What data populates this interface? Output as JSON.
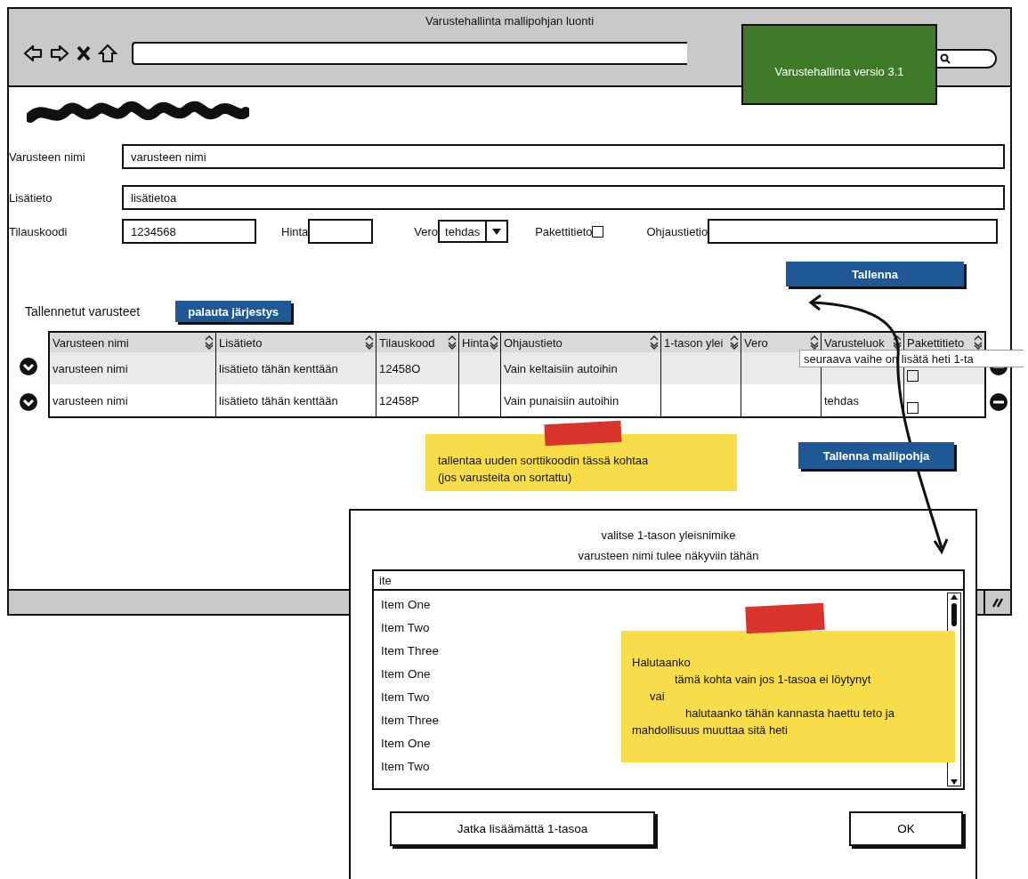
{
  "window": {
    "title": "Varustehallinta mallipohjan luonti"
  },
  "version_badge": "Varustehallinta versio 3.1",
  "form": {
    "rows": [
      {
        "kind": "wide",
        "label": "Varusteen nimi",
        "value": "varusteen nimi"
      },
      {
        "kind": "wide",
        "label": "Lisätieto",
        "value": "lisätietoa"
      }
    ],
    "inline": [
      {
        "kind": "text",
        "label": "Tilauskoodi",
        "value": "1234568"
      },
      {
        "kind": "text",
        "label": "Hinta"
      },
      {
        "kind": "select",
        "label": "Vero",
        "value": "tehdas"
      },
      {
        "kind": "checkbox",
        "label": "Pakettitieto",
        "checked": false
      },
      {
        "kind": "text",
        "label": "Ohjaustietio"
      }
    ]
  },
  "save_button": "Tallenna",
  "saved_label": "Tallennetut varusteet",
  "reset_order_button": "palauta järjestys",
  "table": {
    "columns": [
      "Varusteen nimi",
      "Lisätieto",
      "Tilauskood",
      "Hinta",
      "Ohjaustieto",
      "1-tason ylei",
      "Vero",
      "Varusteluok",
      "Pakettitieto"
    ],
    "rows": [
      {
        "selected": true,
        "cells": [
          {
            "kind": "text",
            "text": "varusteen nimi"
          },
          {
            "kind": "text",
            "text": "lisätieto tähän kenttään"
          },
          {
            "kind": "text",
            "text": "12458O"
          },
          {
            "kind": "empty"
          },
          {
            "kind": "text",
            "text": "Vain keltaisiin autoihin"
          },
          {
            "kind": "empty"
          },
          {
            "kind": "empty"
          },
          {
            "kind": "empty"
          },
          {
            "kind": "checkbox",
            "checked": false
          }
        ]
      },
      {
        "selected": false,
        "cells": [
          {
            "kind": "text",
            "text": "varusteen nimi"
          },
          {
            "kind": "text",
            "text": "lisätieto tähän kenttään"
          },
          {
            "kind": "text",
            "text": "12458P"
          },
          {
            "kind": "empty"
          },
          {
            "kind": "text",
            "text": "Vain punaisiin autoihin"
          },
          {
            "kind": "empty"
          },
          {
            "kind": "empty"
          },
          {
            "kind": "text",
            "text": "tehdas"
          },
          {
            "kind": "checkbox",
            "checked": false
          }
        ]
      }
    ]
  },
  "tooltip": "seuraava vaihe on lisätä heti 1-ta",
  "sticky_note": [
    "tallentaa uuden sorttikoodin tässä kohtaa",
    "(jos varusteita on sortattu)"
  ],
  "save_template_button": "Tallenna mallipohja",
  "dialog": {
    "title": "valitse 1-tason yleisnimike",
    "subtitle": "varusteen nimi tulee näkyviin tähän",
    "search": {
      "value": "ite"
    },
    "items": [
      "Item One",
      "Item Two",
      "Item Three",
      "Item One",
      "Item Two",
      "Item Three",
      "Item One",
      "Item Two"
    ],
    "note": [
      "Halutaanko",
      "tämä kohta vain jos 1-tasoa ei löytynyt",
      "vai",
      "halutaanko tähän kannasta haettu teto ja",
      "mahdollisuus muuttaa sitä heti"
    ],
    "buttons": [
      {
        "kind": "secondary",
        "label": "Jatka lisäämättä 1-tasoa"
      },
      {
        "kind": "primary",
        "label": "OK"
      }
    ]
  }
}
